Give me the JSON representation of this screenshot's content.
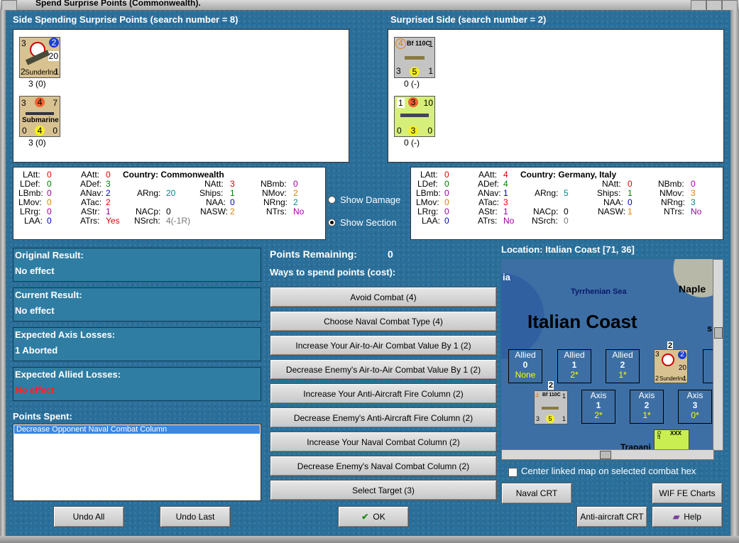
{
  "window": {
    "title": "Spend Surprise Points (Commonwealth)."
  },
  "left_panel": {
    "header": "Side Spending Surprise Points (search number = 8)",
    "units": [
      {
        "name": "Sunderlnd",
        "tl": "3",
        "tr": "2",
        "mid": "20",
        "bl": "2",
        "br": "1",
        "caption": "3 (0)"
      },
      {
        "name": "Submarine",
        "tl": "3",
        "tm": "4",
        "tr": "7",
        "bl": "0",
        "bm": "4",
        "br": "0",
        "caption": "3 (0)"
      }
    ],
    "stats": {
      "latt": "0",
      "ldef": "0",
      "lbmb": "0",
      "lmov": "0",
      "lrrg": "0",
      "laa": "0",
      "aatt": "0",
      "adef": "3",
      "anav": "2",
      "atac": "2",
      "astr": "1",
      "atrs": "Yes",
      "country": "Country: Commonwealth",
      "arng": "20",
      "nacp": "0",
      "nsrch": "4(-1R)",
      "natt": "3",
      "ships": "1",
      "naa": "0",
      "nasw": "2",
      "nbmb": "0",
      "nmov": "2",
      "nrng": "2",
      "ntrs": "No"
    }
  },
  "right_panel": {
    "header": "Surprised Side (search number = 2)",
    "units": [
      {
        "name": "Bf 110C",
        "tl": "4",
        "tr": "1",
        "bl": "3",
        "bm": "5",
        "br": "1",
        "caption": "0 (-)"
      },
      {
        "name": "",
        "tl": "1",
        "tm": "3",
        "tr": "10",
        "bl": "0",
        "bm": "3",
        "br": "0",
        "caption": "0 (-)"
      }
    ],
    "stats": {
      "latt": "0",
      "ldef": "0",
      "lbmb": "0",
      "lmov": "0",
      "lrrg": "0",
      "laa": "0",
      "aatt": "4",
      "adef": "4",
      "anav": "1",
      "atac": "3",
      "astr": "1",
      "atrs": "No",
      "country": "Country: Germany, Italy",
      "arng": "5",
      "nacp": "0",
      "nsrch": "0",
      "natt": "0",
      "ships": "1",
      "naa": "0",
      "nasw": "1",
      "nbmb": "0",
      "nmov": "3",
      "nrng": "3",
      "ntrs": "No"
    }
  },
  "stat_labels": {
    "latt": "LAtt:",
    "ldef": "LDef:",
    "lbmb": "LBmb:",
    "lmov": "LMov:",
    "lrrg": "LRrg:",
    "laa": "LAA:",
    "aatt": "AAtt:",
    "adef": "ADef:",
    "anav": "ANav:",
    "atac": "ATac:",
    "astr": "AStr:",
    "atrs": "ATrs:",
    "arng": "ARng:",
    "nacp": "NACp:",
    "nsrch": "NSrch:",
    "natt": "NAtt:",
    "ships": "Ships:",
    "naa": "NAA:",
    "nasw": "NASW:",
    "nbmb": "NBmb:",
    "nmov": "NMov:",
    "nrng": "NRng:",
    "ntrs": "NTrs:"
  },
  "options": {
    "show_damage": "Show Damage",
    "show_section": "Show Section"
  },
  "results": [
    {
      "label": "Original Result:",
      "value": "No effect"
    },
    {
      "label": "Current Result:",
      "value": "No effect"
    },
    {
      "label": "Expected Axis Losses:",
      "value": "1 Aborted"
    },
    {
      "label": "Expected Allied Losses:",
      "value": "No effect"
    }
  ],
  "points_spent": {
    "label": "Points Spent:",
    "items": [
      "Decrease Opponent Naval Combat Column"
    ]
  },
  "points": {
    "remaining_label": "Points Remaining:",
    "remaining_value": "0",
    "ways_label": "Ways to spend points (cost):"
  },
  "spend_options": [
    "Avoid Combat (4)",
    "Choose Naval Combat Type (4)",
    "Increase Your Air-to-Air Combat Value By 1 (2)",
    "Decrease Enemy's Air-to-Air Combat Value By 1 (2)",
    "Increase Your Anti-Aircraft Fire Column (2)",
    "Decrease Enemy's Anti-Aircraft Fire Column (2)",
    "Increase Your Naval Combat Column (2)",
    "Decrease Enemy's Naval Combat Column (2)",
    "Select Target (3)"
  ],
  "location": {
    "label": "Location: Italian Coast [71, 36]"
  },
  "map": {
    "ia": "ia",
    "sea": "Tyrrhenian Sea",
    "naples": "Naple",
    "s": "s",
    "coast": "Italian Coast",
    "trapani": "Trapani",
    "allied_boxes": [
      {
        "side": "Allied",
        "num": "0",
        "sub": "None"
      },
      {
        "side": "Allied",
        "num": "1",
        "sub": "2*"
      },
      {
        "side": "Allied",
        "num": "2",
        "sub": "1*"
      }
    ],
    "axis_boxes": [
      {
        "side": "Axis",
        "num": "1",
        "sub": "2*"
      },
      {
        "side": "Axis",
        "num": "2",
        "sub": "1*"
      },
      {
        "side": "Axis",
        "num": "3",
        "sub": "0*"
      }
    ],
    "stack_count_allied": "2",
    "stack_count_axis": "2",
    "map_counter_allied": {
      "name": "Sunderlnd",
      "tl": "3",
      "tr": "2",
      "mid": "20",
      "bl": "2",
      "br": "1"
    },
    "map_counter_axis": {
      "name": "Bf 110C",
      "tl": "4",
      "tr": "1",
      "bl": "3",
      "bm": "5",
      "br": "1"
    },
    "xxx": "XXX",
    "ger": "Ger"
  },
  "checkbox": {
    "label": "Center linked map on selected combat hex"
  },
  "buttons": {
    "naval_crt": "Naval CRT",
    "wif_fe_charts": "WIF FE Charts",
    "aa_crt": "Anti-aircraft CRT",
    "help": "Help",
    "undo_all": "Undo All",
    "undo_last": "Undo Last",
    "ok": "OK"
  }
}
